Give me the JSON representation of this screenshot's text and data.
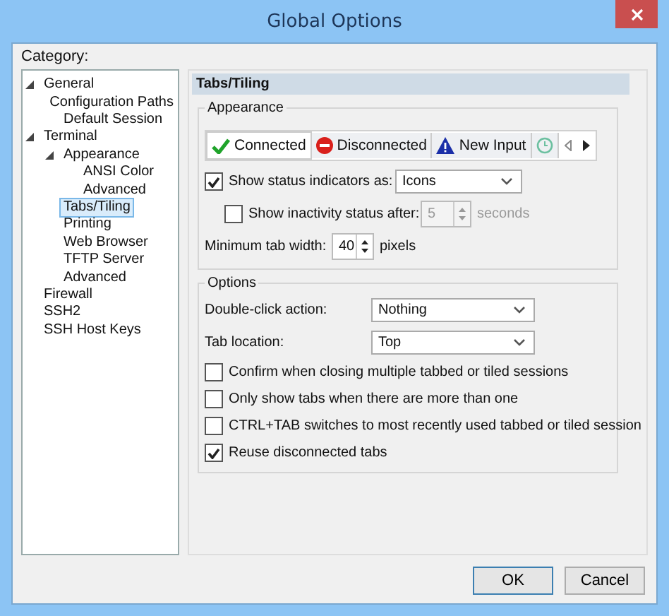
{
  "window": {
    "title": "Global Options"
  },
  "category_label": "Category:",
  "tree": [
    {
      "label": "General",
      "expanded": true,
      "selected": false,
      "children": [
        {
          "label": "Configuration Paths",
          "selected": false
        },
        {
          "label": "Default Session",
          "selected": false
        }
      ]
    },
    {
      "label": "Terminal",
      "expanded": true,
      "selected": false,
      "children": [
        {
          "label": "Appearance",
          "expanded": true,
          "selected": false,
          "children": [
            {
              "label": "ANSI Color",
              "selected": false
            },
            {
              "label": "Advanced",
              "selected": false
            }
          ]
        },
        {
          "label": "Tabs/Tiling",
          "selected": true
        },
        {
          "label": "Printing",
          "selected": false
        },
        {
          "label": "Web Browser",
          "selected": false
        },
        {
          "label": "TFTP Server",
          "selected": false
        },
        {
          "label": "Advanced",
          "selected": false
        }
      ]
    },
    {
      "label": "Firewall",
      "selected": false
    },
    {
      "label": "SSH2",
      "selected": false
    },
    {
      "label": "SSH Host Keys",
      "selected": false
    }
  ],
  "panel": {
    "title": "Tabs/Tiling",
    "appearance": {
      "title": "Appearance",
      "preview_tabs": [
        {
          "kind": "connected",
          "label": "Connected",
          "selected": true
        },
        {
          "kind": "disconnected",
          "label": "Disconnected",
          "selected": false
        },
        {
          "kind": "new_input",
          "label": "New Input",
          "selected": false
        },
        {
          "kind": "clock",
          "selected": false
        }
      ],
      "status_indicators": {
        "label": "Show status indicators as:",
        "checked": true,
        "value": "Icons"
      },
      "inactivity": {
        "label": "Show inactivity status after:",
        "checked": false,
        "value": "5",
        "unit": "seconds",
        "disabled": true
      },
      "min_tab_width": {
        "label": "Minimum tab width:",
        "value": "40",
        "unit": "pixels"
      }
    },
    "options": {
      "title": "Options",
      "double_click": {
        "label": "Double-click action:",
        "value": "Nothing"
      },
      "tab_location": {
        "label": "Tab location:",
        "value": "Top"
      },
      "checkboxes": [
        {
          "label": "Confirm when closing multiple tabbed or tiled sessions",
          "checked": false
        },
        {
          "label": "Only show tabs when there are more than one",
          "checked": false
        },
        {
          "label": "CTRL+TAB switches to most recently used tabbed or tiled session",
          "checked": false
        },
        {
          "label": "Reuse disconnected tabs",
          "checked": true
        }
      ]
    }
  },
  "buttons": [
    {
      "label": "OK",
      "default": true
    },
    {
      "label": "Cancel",
      "default": false
    }
  ]
}
